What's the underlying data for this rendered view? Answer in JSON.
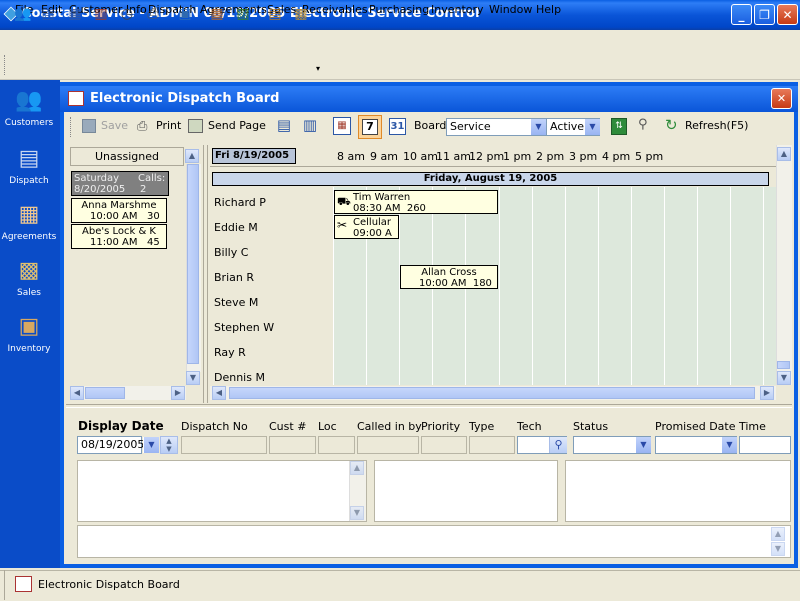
{
  "app": {
    "title": "Coastal Service - ADMIN 08/19/2005 Electronic Service Control"
  },
  "window_buttons": {
    "minimize": "_",
    "maximize": "❐",
    "close": "✕"
  },
  "menu": [
    "File",
    "Edit",
    "Customer Info",
    "Dispatch",
    "Agreements",
    "Sales",
    "Receivables",
    "Purchasing",
    "Inventory",
    "Window",
    "Help"
  ],
  "toolbar_icons": [
    "customers-icon",
    "contact-card-icon",
    "form-icon",
    "calendar-icon",
    "clock-icon",
    "printer-icon",
    "book-icon",
    "register-icon",
    "open-book-icon",
    "notebook-icon",
    "boxes-icon"
  ],
  "leftnav": [
    {
      "label": "Customers",
      "icon": "customers-icon"
    },
    {
      "label": "Dispatch",
      "icon": "dispatch-icon"
    },
    {
      "label": "Agreements",
      "icon": "agreements-icon"
    },
    {
      "label": "Sales",
      "icon": "sales-icon"
    },
    {
      "label": "Inventory",
      "icon": "inventory-icon"
    }
  ],
  "child": {
    "title": "Electronic Dispatch Board",
    "close": "✕"
  },
  "dispatch_toolbar": {
    "save": "Save",
    "print": "Print",
    "send_page": "Send Page",
    "day7": "7",
    "day31": "31",
    "board_label": "Board",
    "board_value": "Service",
    "status_value": "Active",
    "refresh": "Refresh(F5)"
  },
  "unassigned": {
    "header": "Unassigned",
    "summary": {
      "day": "Saturday",
      "calls_label": "Calls:",
      "date": "8/20/2005",
      "count": "2"
    },
    "cards": [
      {
        "name": "Anna Marshme",
        "time": "10:00 AM",
        "duration": "30"
      },
      {
        "name": "Abe's Lock & K",
        "time": "11:00 AM",
        "duration": "45"
      }
    ]
  },
  "schedule": {
    "date_tab": "Fri 8/19/2005",
    "date_band": "Friday, August 19, 2005",
    "hours": [
      "8 am",
      "9 am",
      "10 am",
      "11 am",
      "12 pm",
      "1 pm",
      "2 pm",
      "3 pm",
      "4 pm",
      "5 pm"
    ],
    "techs": [
      "Richard P",
      "Eddie M",
      "Billy C",
      "Brian R",
      "Steve M",
      "Stephen W",
      "Ray R",
      "Dennis M"
    ],
    "appointments": [
      {
        "tech": "Richard P",
        "name": "Tim Warren",
        "time": "08:30 AM",
        "duration": "260",
        "icon": "truck-icon"
      },
      {
        "tech": "Eddie M",
        "name": "Cellular",
        "time": "09:00 A",
        "duration": "",
        "icon": "tools-icon"
      },
      {
        "tech": "Brian R",
        "name": "Allan Cross",
        "time": "10:00 AM",
        "duration": "180",
        "icon": ""
      }
    ]
  },
  "form": {
    "display_date_label": "Display Date",
    "display_date_value": "08/19/2005",
    "dispatch_no": "Dispatch No",
    "cust_no": "Cust #",
    "loc": "Loc",
    "called_by": "Called in by",
    "priority": "Priority",
    "type": "Type",
    "tech": "Tech",
    "status": "Status",
    "promised_date": "Promised Date",
    "time": "Time"
  },
  "taskbar": {
    "item": "Electronic Dispatch Board"
  }
}
